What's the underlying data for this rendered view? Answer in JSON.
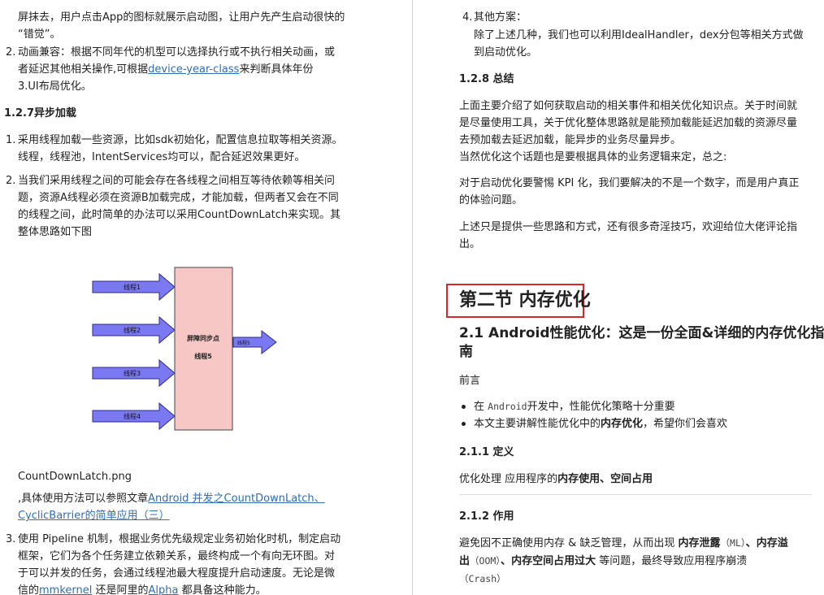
{
  "left": {
    "intro_line1": "屏抹去，用户点击App的图标就展示启动图，让用户先产生启动很快的",
    "intro_line2": "“错觉”。",
    "item2_num": "2.",
    "item2_line1": "动画兼容：根据不同年代的机型可以选择执行或不执行相关动画，或",
    "item2_line2a": "者延迟其他相关操作,可根据",
    "item2_link": "device-year-class",
    "item2_line2b": "来判断具体年份",
    "item2_line3": "3.UI布局优化。",
    "heading_async": "1.2.7异步加载",
    "async1_num": "1.",
    "async1_line1": "采用线程加载一些资源，比如sdk初始化，配置信息拉取等相关资源。",
    "async1_line2": "线程，线程池，IntentServices均可以，配合延迟效果更好。",
    "async2_num": "2.",
    "async2_line1": "当我们采用线程之间的可能会存在各线程之间相互等待依赖等相关问",
    "async2_line2": "题，资源A线程必须在资源B加载完成，才能加载，但两者又会在不同",
    "async2_line3": "的线程之间，此时简单的办法可以采用CountDownLatch来实现。其",
    "async2_line4": "整体思路如下图",
    "diagram": {
      "threads": [
        "线程1",
        "线程2",
        "线程3",
        "线程4"
      ],
      "barrier_label": "屏障同步点",
      "barrier_thread": "线程5",
      "out_label": "线程5"
    },
    "caption": "CountDownLatch.png",
    "ref_prefix": ",具体使用方法可以参照文章",
    "ref_link1": "Android 并发之CountDownLatch、",
    "ref_link2": "CyclicBarrier的简单应用（三）",
    "item3_num": "3.",
    "item3_line1": "使用 Pipeline 机制，根据业务优先级规定业务初始化时机，制定启动",
    "item3_line2": "框架，它们为各个任务建立依赖关系，最终构成一个有向无环图。对",
    "item3_line3": "于可以并发的任务，会通过线程池最大程度提升启动速度。无论是微",
    "item3_line4a": "信的",
    "item3_link1": "mmkernel",
    "item3_line4b": " 还是阿里的",
    "item3_link2": "Alpha",
    "item3_line4c": " 都具备这种能力。"
  },
  "right": {
    "item4_num": "4.",
    "item4_title": "其他方案：",
    "item4_line1": "除了上述几种，我们也可以利用IdealHandler，dex分包等相关方式做",
    "item4_line2": "到启动优化。",
    "heading_summary": "1.2.8 总结",
    "sum_line1": "上面主要介绍了如何获取启动的相关事件和相关优化知识点。关于时间就",
    "sum_line2": "是尽量使用工具，关于优化整体思路就是能预加载能延迟加载的资源尽量",
    "sum_line3": "去预加载去延迟加载，能异步的业务尽量异步。",
    "sum_line4": "当然优化这个话题也是要根据具体的业务逻辑来定，总之:",
    "kpi_line1": "对于启动优化要警惕 KPI 化，我们要解决的不是一个数字，而是用户真正",
    "kpi_line2": "的体验问题。",
    "end_line1": "上述只是提供一些思路和方式，还有很多奇淫技巧，欢迎给位大佬评论指",
    "end_line2": "出。",
    "section_title": "第二节 内存优化",
    "h2_line1": "2.1 Android性能优化：这是一份全面&详细的内存优化指",
    "h2_line2": "南",
    "preface": "前言",
    "bullet1a": "在 ",
    "bullet1_code": "Android",
    "bullet1b": "开发中，性能优化策略十分重要",
    "bullet2a": "本文主要讲解性能优化中的",
    "bullet2_bold": "内存优化",
    "bullet2b": "，希望你们会喜欢",
    "heading_def": "2.1.1 定义",
    "def_a": "优化处理 应用程序的",
    "def_bold": "内存使用、空间占用",
    "heading_role": "2.1.2 作用",
    "role_a": "避免因不正确使用内存 & 缺乏管理，从而出现 ",
    "role_b1": "内存泄露",
    "role_c1": "（ML）",
    "role_sep1": "、",
    "role_b2": "内存溢",
    "role_b2b": "出",
    "role_c2": "（OOM）",
    "role_sep2": "、",
    "role_b3": "内存空间占用过大",
    "role_d": " 等问题，最终导致应用程序崩溃",
    "role_c3": "（Crash）"
  },
  "colors": {
    "link": "#2f6db5",
    "arrow_fill": "#7b79f2",
    "arrow_stroke": "#2c2b8f",
    "barrier_fill": "#f7c7c5",
    "highlight_border": "#d9262c"
  }
}
